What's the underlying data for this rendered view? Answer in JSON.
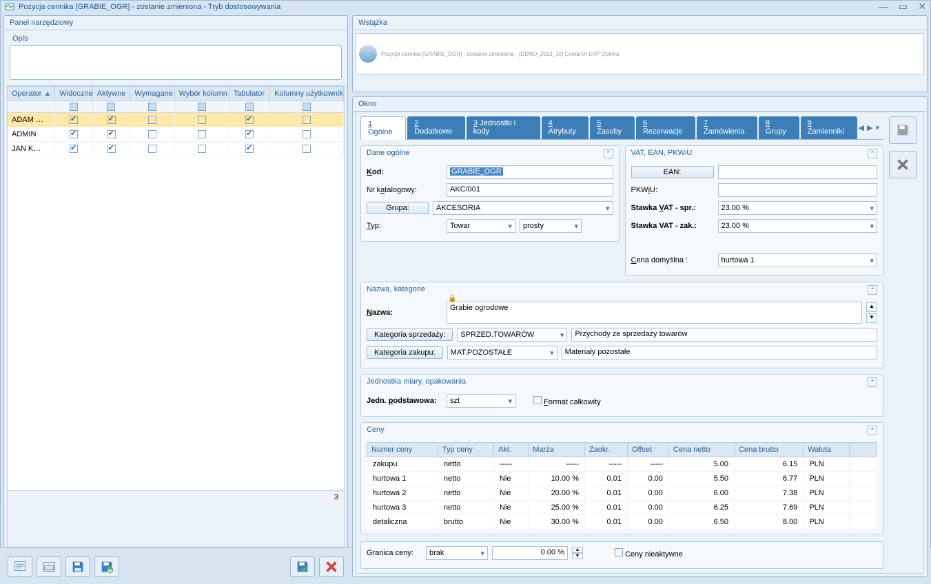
{
  "titlebar": {
    "text": "Pozycja cennika [GRABIE_OGR] - zostanie zmieniona - Tryb dostosowywania"
  },
  "left_panel": {
    "title": "Panel narzędziowy",
    "opis_title": "Opis",
    "columns": {
      "op": "Operator",
      "vis": "Widoczne",
      "akt": "Aktywne",
      "wym": "Wymagane",
      "wk": "Wybór kolumn",
      "tab": "Tabulator",
      "kol": "Kolumny użytkownika"
    },
    "rows": [
      {
        "name": "ADAM …",
        "vis": true,
        "akt": true,
        "wym": false,
        "wk": false,
        "tab": true,
        "kol": false,
        "selected": true
      },
      {
        "name": "ADMIN",
        "vis": true,
        "akt": true,
        "wym": false,
        "wk": false,
        "tab": true,
        "kol": false,
        "selected": false
      },
      {
        "name": "JAN K…",
        "vis": true,
        "akt": true,
        "wym": false,
        "wk": false,
        "tab": true,
        "kol": false,
        "selected": false
      }
    ],
    "count": "3"
  },
  "ribbon": {
    "title": "Wstążka",
    "preview": "Pozycja cennika [GRABIE_OGR] - zostanie zmieniona - [DEMO_2013_10] Comarch ERP Optima"
  },
  "okno": {
    "title": "Okno"
  },
  "tabs": [
    "1 Ogólne",
    "2 Dodatkowe",
    "3 Jednostki i kody",
    "4 Atrybuty",
    "5 Zasoby",
    "6 Rezerwacje",
    "7 Zamówienia",
    "8 Grupy",
    "9 Zamienniki"
  ],
  "dane_ogolne": {
    "title": "Dane ogólne",
    "kod_lbl": "Kod:",
    "kod_val": "GRABIE_OGR",
    "kat_lbl": "Nr katalogowy:",
    "kat_val": "AKC/001",
    "grupa_btn": "Grupa:",
    "grupa_val": "AKCESORIA",
    "typ_lbl": "Typ:",
    "typ_val": "Towar",
    "prosty_val": "prosty"
  },
  "vat": {
    "title": "VAT, EAN, PKWiU",
    "ean_btn": "EAN:",
    "ean_val": "",
    "pkwiu_lbl": "PKWiU:",
    "pkwiu_val": "",
    "vsp_lbl": "Stawka VAT - spr.:",
    "vsp_val": "23.00 %",
    "vza_lbl": "Stawka VAT - zak.:",
    "vza_val": "23.00 %",
    "cen_lbl": "Cena domyślna :",
    "cen_val": "hurtowa 1"
  },
  "nazwa": {
    "title": "Nazwa, kategorie",
    "nazwa_lbl": "Nazwa:",
    "nazwa_val": "Grabie ogrodowe",
    "kspr_btn": "Kategoria sprzedaży:",
    "kspr_val": "SPRZED.TOWARÓW",
    "kspr_desc": "Przychody ze sprzedaży towarów",
    "kzak_btn": "Kategoria zakupu:",
    "kzak_val": "MAT.POZOSTAŁE",
    "kzak_desc": "Materiały pozostałe"
  },
  "jedn": {
    "title": "Jednostka miary, opakowania",
    "lbl": "Jedn. podstawowa:",
    "val": "szt",
    "format_lbl": "Format całkowity"
  },
  "ceny": {
    "title": "Ceny",
    "headers": [
      "Numer ceny",
      "Typ ceny",
      "Akt.",
      "Marża",
      "Zaokr.",
      "Offset",
      "Cena netto",
      "Cena brutto",
      "Waluta"
    ],
    "rows": [
      [
        "zakupu",
        "netto",
        "-----",
        "-----",
        "-----",
        "-----",
        "5.00",
        "6.15",
        "PLN"
      ],
      [
        "hurtowa 1",
        "netto",
        "Nie",
        "10.00 %",
        "0.01",
        "0.00",
        "5.50",
        "6.77",
        "PLN"
      ],
      [
        "hurtowa 2",
        "netto",
        "Nie",
        "20.00 %",
        "0.01",
        "0.00",
        "6.00",
        "7.38",
        "PLN"
      ],
      [
        "hurtowa 3",
        "netto",
        "Nie",
        "25.00 %",
        "0.01",
        "0.00",
        "6.25",
        "7.69",
        "PLN"
      ],
      [
        "detaliczna",
        "brutto",
        "Nie",
        "30.00 %",
        "0.01",
        "0.00",
        "6.50",
        "8.00",
        "PLN"
      ]
    ],
    "granica_lbl": "Granica ceny:",
    "granica_val": "brak",
    "percent_val": "0.00 %",
    "nieakt_lbl": "Ceny nieaktywne"
  }
}
